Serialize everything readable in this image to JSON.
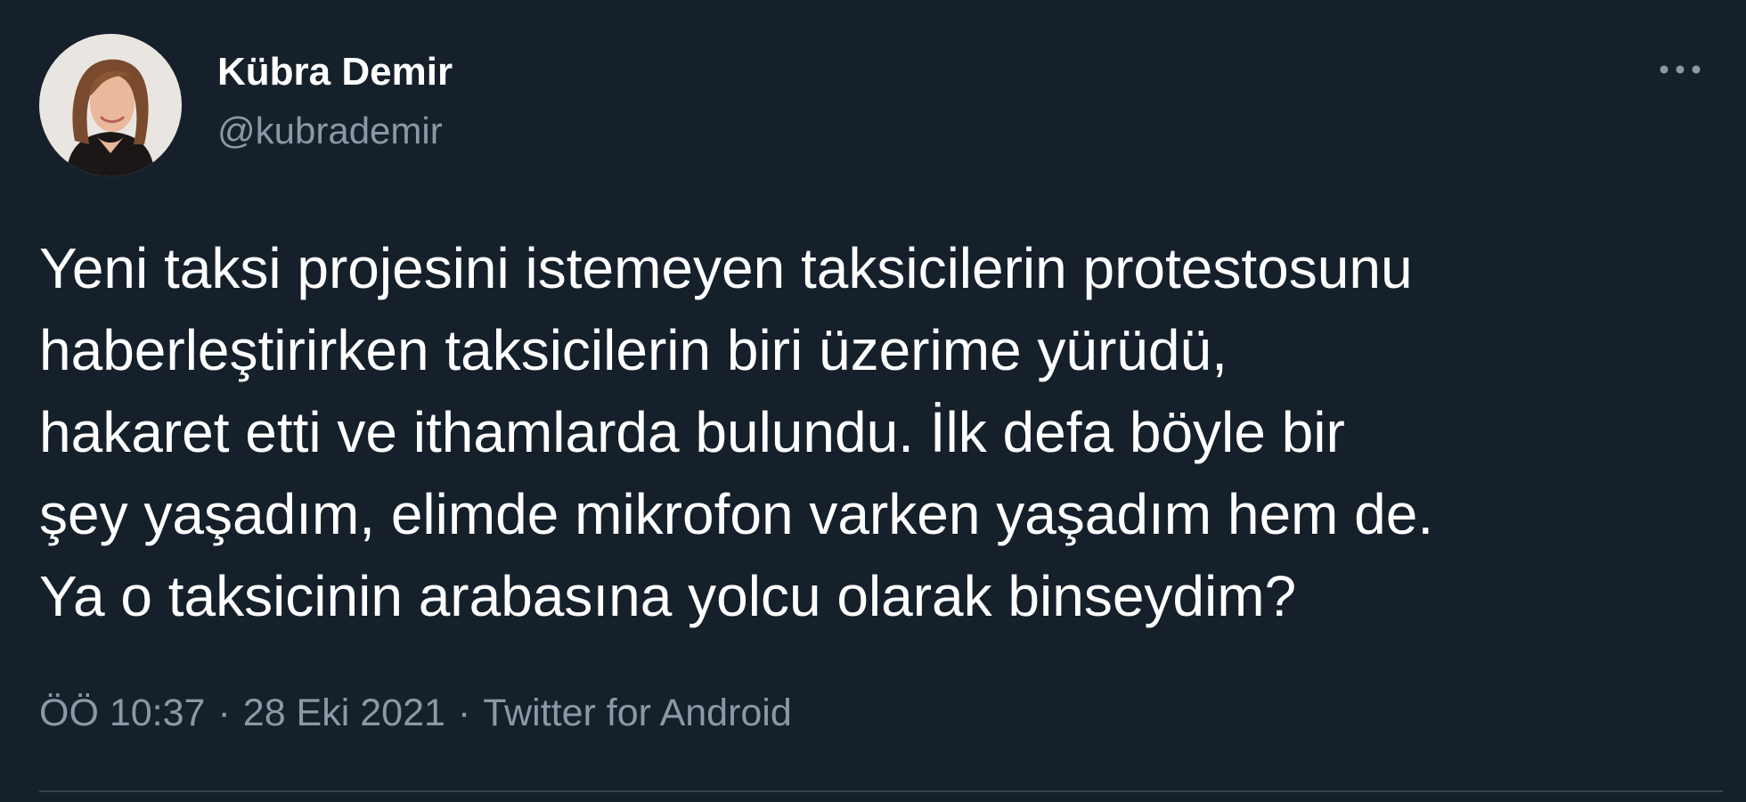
{
  "author": {
    "name": "Kübra Demir",
    "handle": "@kubrademir"
  },
  "more_menu": {
    "icon": "ellipsis-icon"
  },
  "tweet": {
    "lines": [
      "Yeni taksi projesini istemeyen taksicilerin protestosunu",
      "haberleştirirken taksicilerin biri üzerime yürüdü,",
      "hakaret etti ve ithamlarda bulundu. İlk defa böyle bir",
      "şey yaşadım, elimde mikrofon varken yaşadım hem de.",
      "Ya o taksicinin arabasına yolcu olarak binseydim?"
    ]
  },
  "meta": {
    "time": "ÖÖ 10:37",
    "separator": "·",
    "date": "28 Eki 2021",
    "source": "Twitter for Android"
  },
  "colors": {
    "background": "#15202b",
    "text_primary": "#ffffff",
    "text_secondary": "#8b98a5",
    "divider": "#38444d"
  }
}
